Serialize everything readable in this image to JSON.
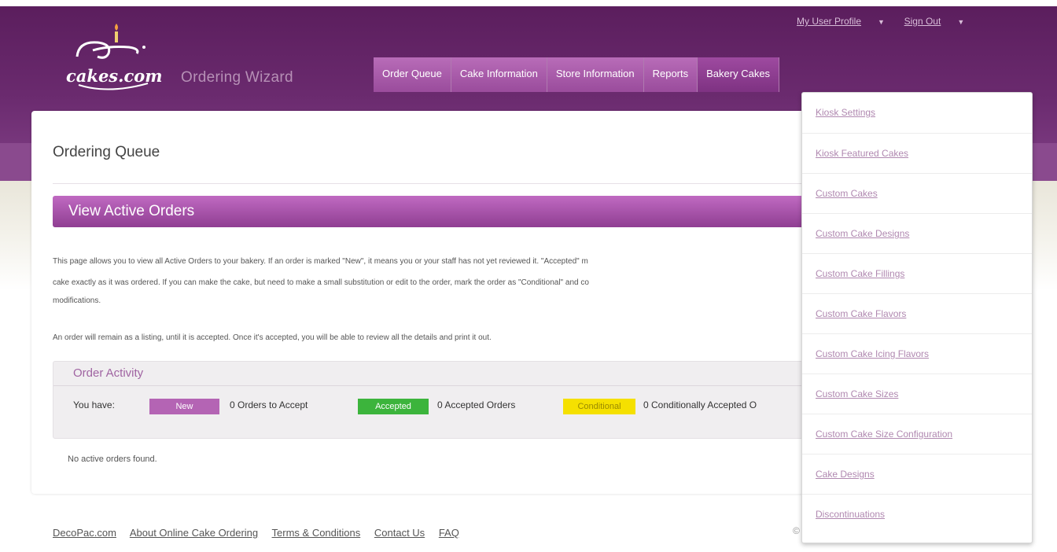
{
  "header": {
    "logo_text": "cakes.com",
    "subtitle": "Ordering Wizard",
    "user_links": [
      {
        "label": "My User Profile"
      },
      {
        "label": "Sign Out"
      }
    ],
    "nav": [
      {
        "label": "Order Queue"
      },
      {
        "label": "Cake Information"
      },
      {
        "label": "Store Information"
      },
      {
        "label": "Reports"
      },
      {
        "label": "Bakery Cakes",
        "active": true
      }
    ]
  },
  "main": {
    "title": "Ordering Queue",
    "section_title": "View Active Orders",
    "para1_line1": "This page allows you to view all Active Orders to your bakery. If an order is marked \"New\", it means you or your staff has not yet reviewed it. \"Accepted\" m",
    "para1_line2": "cake exactly as it was ordered. If you can make the cake, but need to make a small substitution or edit to the order, mark the order as \"Conditional\" and co",
    "para1_line3": "modifications.",
    "para2": "An order will remain as a listing, until it is accepted. Once it's accepted, you will be able to review all the details and print it out.",
    "activity": {
      "title": "Order Activity",
      "you_have": "You have:",
      "new_label": "New",
      "new_text": "0 Orders to Accept",
      "accepted_label": "Accepted",
      "accepted_text": "0 Accepted Orders",
      "conditional_label": "Conditional",
      "conditional_text": "0 Conditionally Accepted O",
      "colors": {
        "new": "#b464b4",
        "accepted": "#3cb43c",
        "conditional": "#f5e000"
      }
    },
    "empty_message": "No active orders found."
  },
  "dropdown": {
    "items": [
      "Kiosk Settings",
      "Kiosk Featured Cakes",
      "Custom Cakes",
      "Custom Cake Designs",
      "Custom Cake Fillings",
      "Custom Cake Flavors",
      "Custom Cake Icing Flavors",
      "Custom Cake Sizes",
      "Custom Cake Size Configuration",
      "Cake Designs",
      "Discontinuations"
    ]
  },
  "footer": {
    "links": [
      "DecoPac.com",
      "About Online Cake Ordering",
      "Terms & Conditions",
      "Contact Us",
      "FAQ"
    ],
    "copyright": "©"
  }
}
